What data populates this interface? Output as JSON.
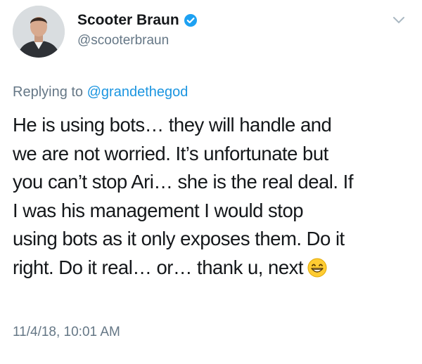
{
  "author": {
    "display_name": "Scooter Braun",
    "handle": "@scooterbraun",
    "verified": true,
    "avatar_icon": "profile-photo"
  },
  "reply": {
    "prefix": "Replying to",
    "mention": "@grandethegod"
  },
  "tweet": {
    "lines": [
      "He is using bots… they will handle and",
      "we are not worried. It’s unfortunate but",
      "you can’t stop Ari… she is the real deal. If",
      "I was his management I would stop",
      "using bots as it only exposes them. Do it",
      "right. Do it real… or… thank u, next"
    ],
    "emoji": "grinning-face-with-smiling-eyes"
  },
  "timestamp": "11/4/18, 10:01 AM",
  "colors": {
    "text": "#14171a",
    "secondary": "#657786",
    "link": "#1b95e0",
    "verified_badge": "#1da1f2"
  }
}
